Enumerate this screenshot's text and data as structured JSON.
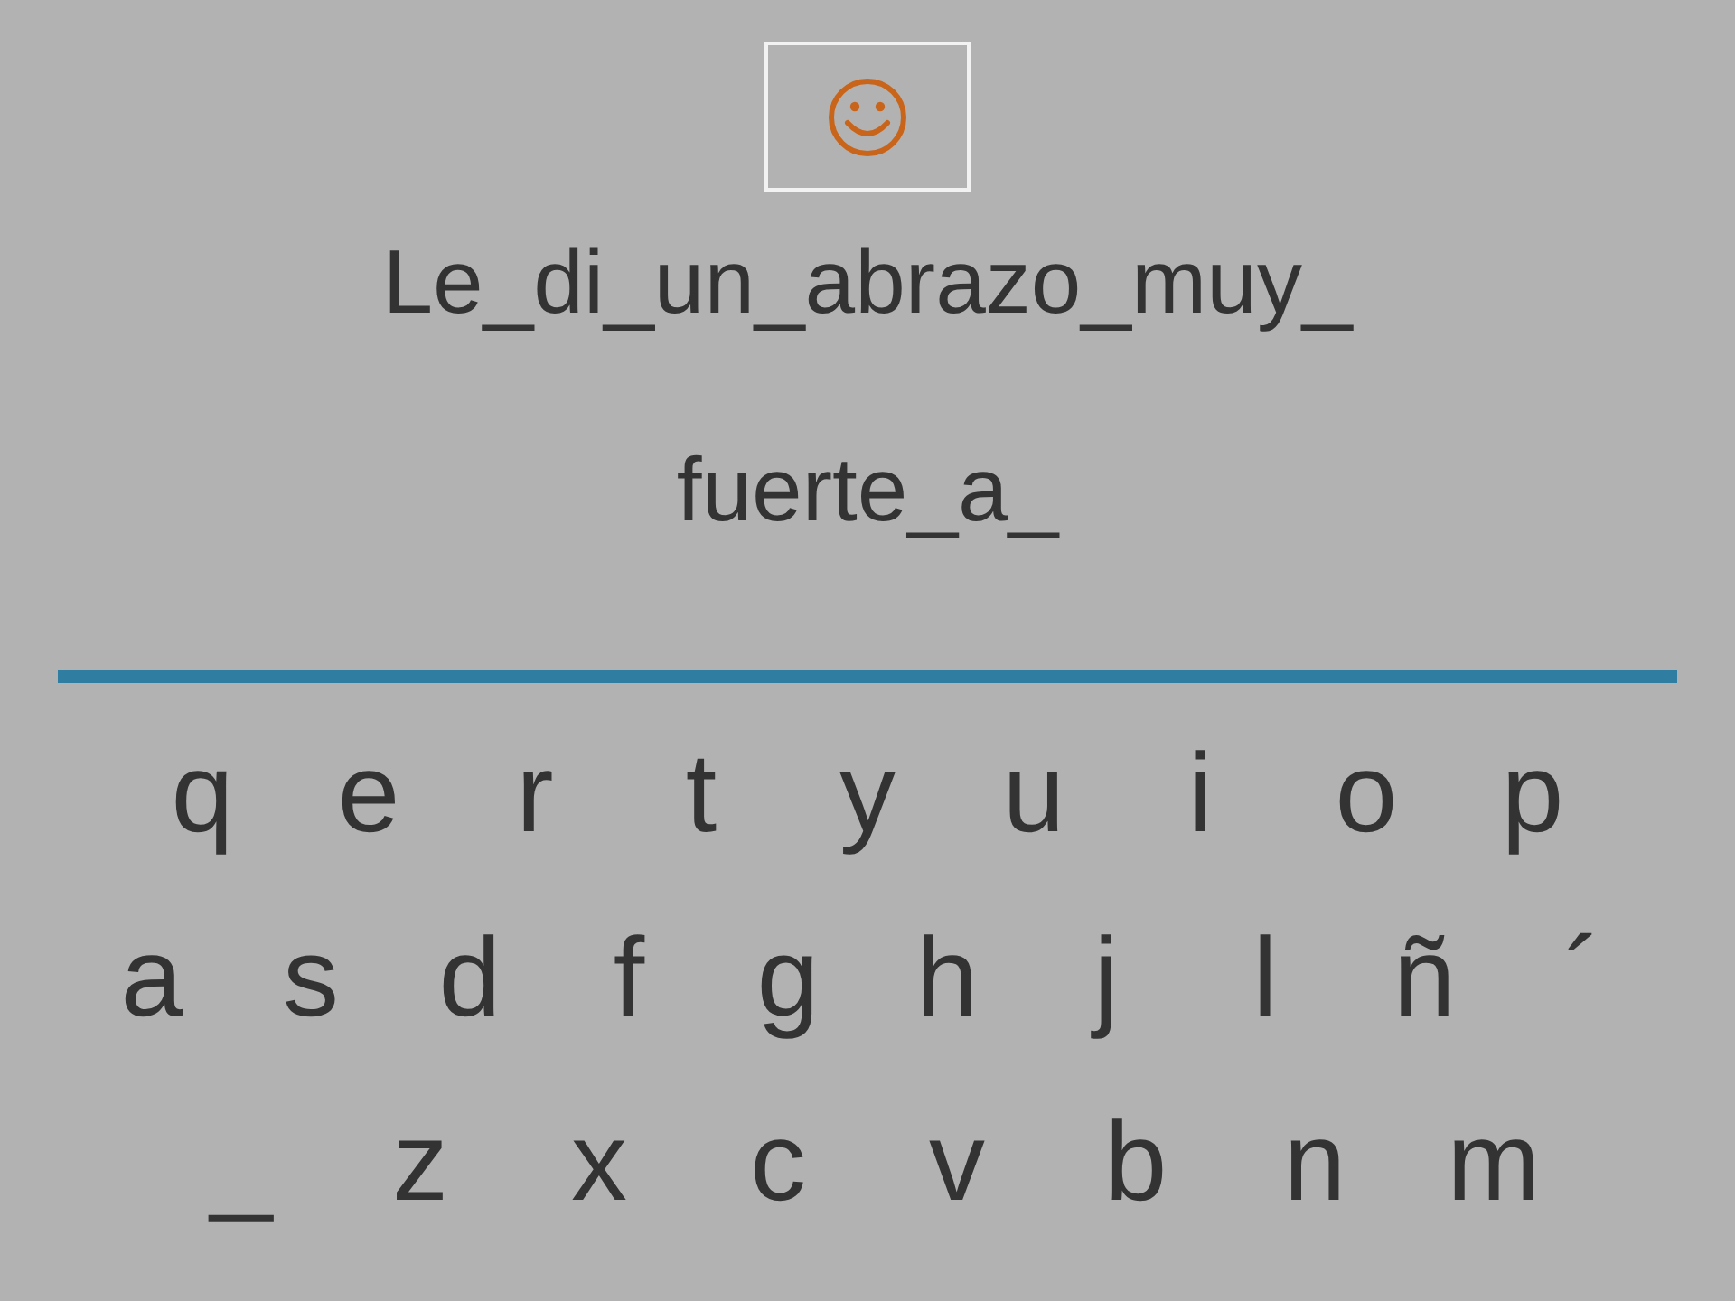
{
  "sentence_lines": [
    "Le_di_un_abrazo_muy_",
    "fuerte_a_"
  ],
  "keyboard": {
    "rows": [
      [
        "q",
        "e",
        "r",
        "t",
        "y",
        "u",
        "i",
        "o",
        "p"
      ],
      [
        "a",
        "s",
        "d",
        "f",
        "g",
        "h",
        "j",
        "l",
        "ñ",
        "´"
      ],
      [
        "_",
        "z",
        "x",
        "c",
        "v",
        "b",
        "n",
        "m"
      ]
    ]
  }
}
